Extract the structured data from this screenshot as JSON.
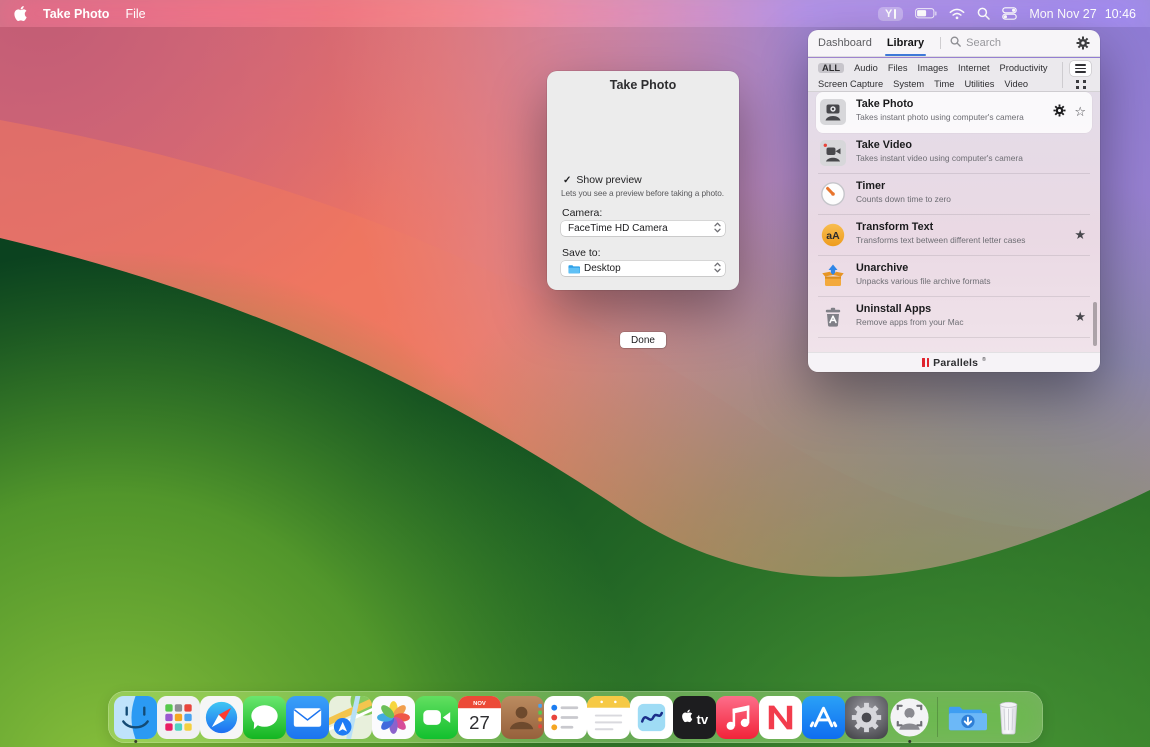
{
  "menu_bar": {
    "app_name": "Take Photo",
    "menus": [
      "File"
    ],
    "status": {
      "toolbox_glyph": "Y",
      "date": "Mon Nov 27",
      "time": "10:46"
    }
  },
  "dialog": {
    "title": "Take Photo",
    "show_preview_label": "Show preview",
    "show_preview_description": "Lets you see a preview before taking a photo.",
    "camera_label": "Camera:",
    "camera_value": "FaceTime HD Camera",
    "save_to_label": "Save to:",
    "save_to_value": "Desktop",
    "done_label": "Done"
  },
  "toolbox_panel": {
    "tabs": [
      {
        "label": "Dashboard",
        "active": false
      },
      {
        "label": "Library",
        "active": true
      }
    ],
    "search_placeholder": "Search",
    "filters_row1": [
      "ALL",
      "Audio",
      "Files",
      "Images",
      "Internet",
      "Productivity"
    ],
    "filters_row2": [
      "Screen Capture",
      "System",
      "Time",
      "Utilities",
      "Video"
    ],
    "active_filter": "ALL",
    "tools": [
      {
        "name": "Take Photo",
        "description": "Takes instant photo using computer's camera",
        "selected": true,
        "favorite": false
      },
      {
        "name": "Take Video",
        "description": "Takes instant video using computer's camera",
        "selected": false,
        "favorite": false
      },
      {
        "name": "Timer",
        "description": "Counts down time to zero",
        "selected": false,
        "favorite": false
      },
      {
        "name": "Transform Text",
        "description": "Transforms text between different letter cases",
        "selected": false,
        "favorite": true
      },
      {
        "name": "Unarchive",
        "description": "Unpacks various file archive formats",
        "selected": false,
        "favorite": false
      },
      {
        "name": "Uninstall Apps",
        "description": "Remove apps from your Mac",
        "selected": false,
        "favorite": true
      }
    ],
    "brand": "Parallels",
    "brand_mark": "®"
  },
  "glyphs": {
    "check": "✓",
    "star_filled": "★",
    "star_outline": "☆",
    "transform_text": "aA"
  },
  "dock": {
    "items": [
      "Finder",
      "Launchpad",
      "Safari",
      "Messages",
      "Mail",
      "Maps",
      "Photos",
      "FaceTime",
      "Calendar",
      "Contacts",
      "Reminders",
      "Notes",
      "Freeform",
      "TV",
      "Music",
      "News",
      "App Store",
      "System Settings",
      "Take Photo",
      "Downloads",
      "Trash"
    ],
    "running": [
      "Finder",
      "Take Photo"
    ],
    "calendar": {
      "month": "NOV",
      "day": "27"
    },
    "tv_label": "tv"
  },
  "colors": {
    "tab_underline": "#3e79d8",
    "brand_red": "#e0232e",
    "selected_filter_pill": "#c7c5cb",
    "wallpaper_purple": "#8e7bd4",
    "wallpaper_coral": "#ee7462",
    "wallpaper_dark_green": "#0c4420",
    "wallpaper_bright_green": "#8cc23d"
  }
}
